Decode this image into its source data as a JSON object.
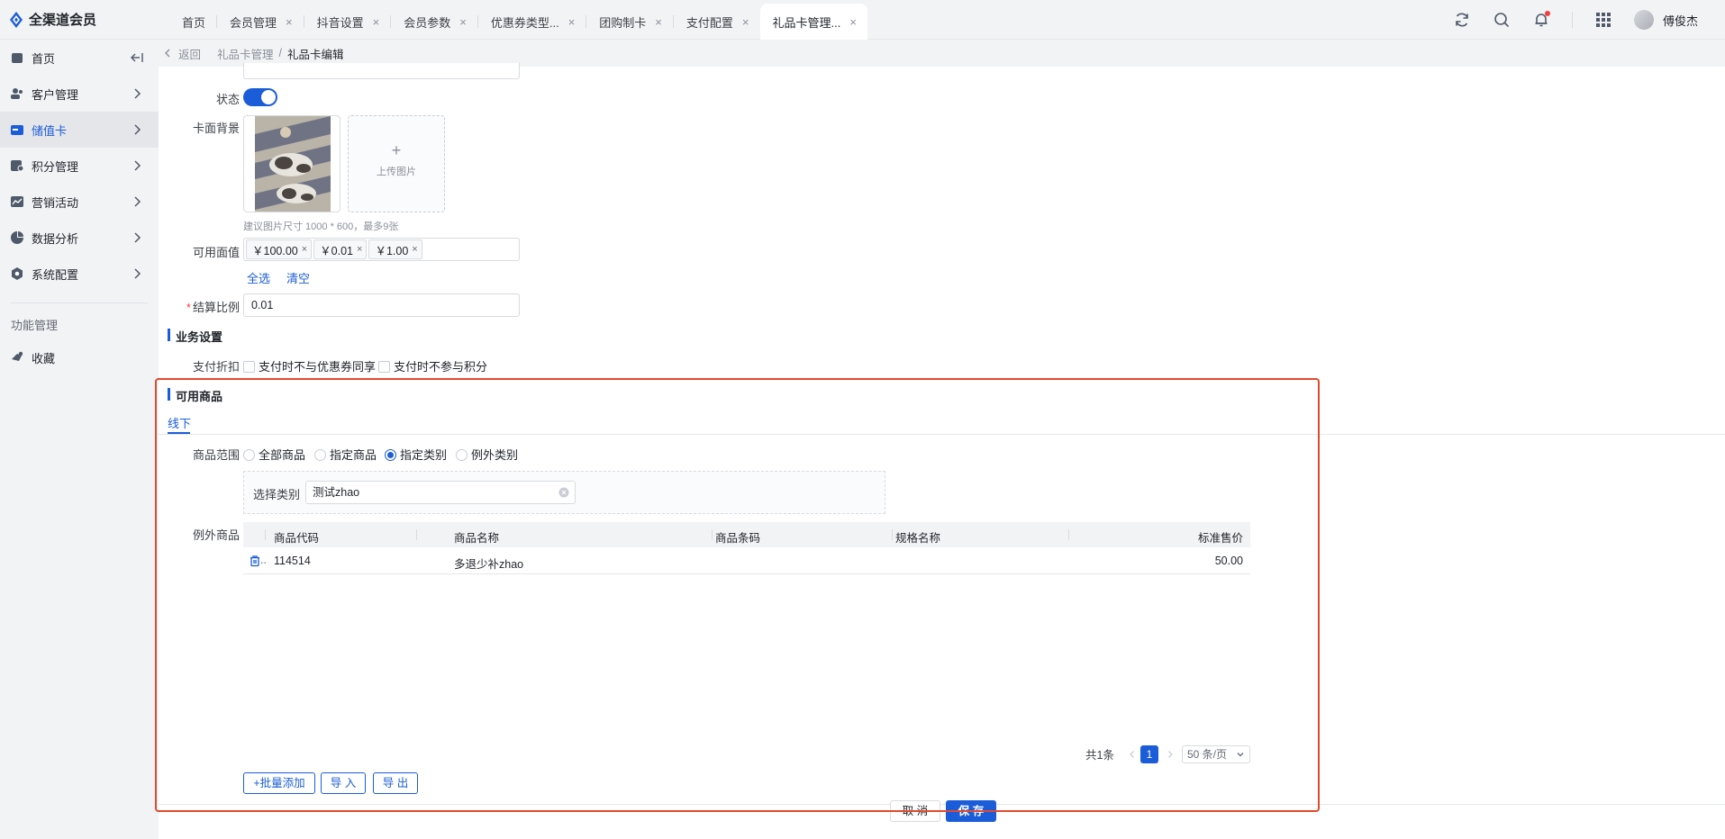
{
  "app": {
    "name": "全渠道会员"
  },
  "tabs": [
    {
      "label": "首页",
      "closable": false,
      "active": false
    },
    {
      "label": "会员管理",
      "closable": true,
      "active": false
    },
    {
      "label": "抖音设置",
      "closable": true,
      "active": false
    },
    {
      "label": "会员参数",
      "closable": true,
      "active": false
    },
    {
      "label": "优惠券类型...",
      "closable": true,
      "active": false
    },
    {
      "label": "团购制卡",
      "closable": true,
      "active": false
    },
    {
      "label": "支付配置",
      "closable": true,
      "active": false
    },
    {
      "label": "礼品卡管理...",
      "closable": true,
      "active": true
    }
  ],
  "user": {
    "name": "傅俊杰"
  },
  "icons": {
    "tab_close": "×"
  },
  "sidebar": {
    "items": [
      {
        "label": "首页",
        "icon": "home-icon"
      },
      {
        "label": "客户管理",
        "icon": "users-icon"
      },
      {
        "label": "储值卡",
        "icon": "card-icon",
        "active": true
      },
      {
        "label": "积分管理",
        "icon": "points-icon"
      },
      {
        "label": "营销活动",
        "icon": "chart-icon"
      },
      {
        "label": "数据分析",
        "icon": "pie-icon"
      },
      {
        "label": "系统配置",
        "icon": "gear-icon"
      }
    ],
    "group_label": "功能管理",
    "favorite_label": "收藏"
  },
  "breadcrumb": {
    "back": "返回",
    "parent": "礼品卡管理",
    "separator": "/",
    "current": "礼品卡编辑"
  },
  "form": {
    "status_label": "状态",
    "status_on": true,
    "card_bg_label": "卡面背景",
    "upload_label": "上传图片",
    "upload_plus": "+",
    "image_hint": "建议图片尺寸 1000 * 600，最多9张",
    "face_value_label": "可用面值",
    "face_values": [
      "￥100.00",
      "￥0.01",
      "￥1.00"
    ],
    "select_all": "全选",
    "clear": "清空",
    "settle_required_mark": "*",
    "settle_label": "结算比例",
    "settle_value": "0.01"
  },
  "business": {
    "title": "业务设置",
    "discount_label": "支付折扣",
    "options": [
      "支付时不与优惠券同享",
      "支付时不参与积分"
    ]
  },
  "goods": {
    "title": "可用商品",
    "tab": "线下",
    "range_label": "商品范围",
    "range_options": [
      "全部商品",
      "指定商品",
      "指定类别",
      "例外类别"
    ],
    "range_selected": "指定类别",
    "category_label": "选择类别",
    "category_value": "测试zhao",
    "exception_label": "例外商品",
    "columns": [
      "商品代码",
      "商品名称",
      "商品条码",
      "规格名称",
      "标准售价"
    ],
    "rows": [
      {
        "code": "114514",
        "name": "多退少补zhao",
        "barcode": "",
        "spec": "",
        "price": "50.00"
      }
    ],
    "row_action_suffix": "..",
    "total": "共1条",
    "current_page": "1",
    "page_size": "50 条/页",
    "batch_add": "+批量添加",
    "import": "导 入",
    "export": "导 出"
  },
  "footer": {
    "cancel": "取 消",
    "save": "保 存"
  },
  "colors": {
    "accent": "#1b5dd8",
    "highlight": "#e04a2e",
    "danger": "#f53f3f"
  }
}
